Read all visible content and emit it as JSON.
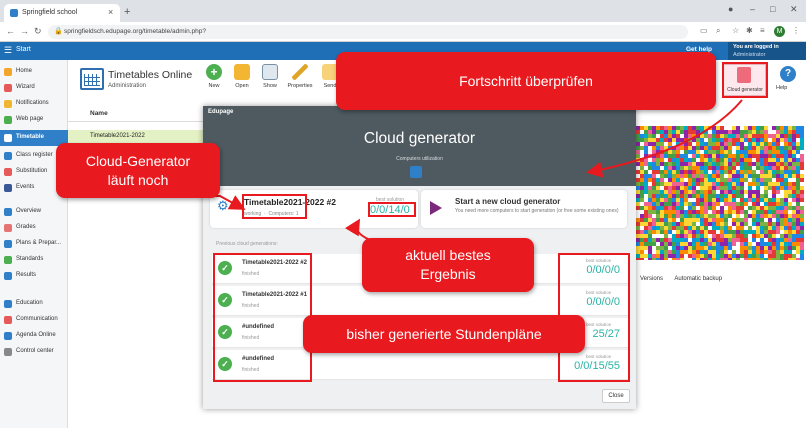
{
  "browser": {
    "tab_title": "Springfield school",
    "tab_close": "×",
    "new_tab": "+",
    "url": "springfieldsch.edupage.org/timetable/admin.php?",
    "avatar_letter": "M"
  },
  "appbar": {
    "start_label": "Start",
    "help_label": "Get help",
    "logged_line1": "You are logged in",
    "logged_line2": "Administrator"
  },
  "sidebar": {
    "items": [
      {
        "label": "Home",
        "color": "#f4a52b"
      },
      {
        "label": "Wizard",
        "color": "#e65a5a"
      },
      {
        "label": "Notifications",
        "color": "#f2b632"
      },
      {
        "label": "Web page",
        "color": "#4caf50"
      },
      {
        "label": "Timetable",
        "color": "#ffffff"
      },
      {
        "label": "Class register",
        "color": "#2f80c9"
      },
      {
        "label": "Substitution",
        "color": "#e65a5a"
      },
      {
        "label": "Events",
        "color": "#3b5998"
      },
      {
        "label": "Overview",
        "color": "#2f80c9"
      },
      {
        "label": "Grades",
        "color": "#e57373"
      },
      {
        "label": "Plans & Prepar...",
        "color": "#2f80c9"
      },
      {
        "label": "Standards",
        "color": "#4caf50"
      },
      {
        "label": "Results",
        "color": "#2f80c9"
      },
      {
        "label": "Education",
        "color": "#2f80c9"
      },
      {
        "label": "Communication",
        "color": "#e65a5a"
      },
      {
        "label": "Agenda Online",
        "color": "#2f80c9"
      },
      {
        "label": "Control center",
        "color": "#888888"
      }
    ]
  },
  "timetables": {
    "title": "Timetables Online",
    "subtitle": "Administration",
    "toolbar": [
      "New",
      "Open",
      "Show",
      "Properties",
      "Send"
    ],
    "list_header": "Name",
    "list_row": "Timetable2021-2022",
    "cloud_btn": "Cloud generator",
    "help_btn": "Help",
    "tabs_behind": [
      "Versions",
      "Automatic backup"
    ]
  },
  "modal": {
    "brand": "Edupage",
    "title": "Cloud generator",
    "utilization": "Computers utilization",
    "running": {
      "name": "Timetable2021-2022 #2",
      "status": "working",
      "computers": "Computers: 1",
      "best_label": "best solution",
      "best_value": "0/0/14/0"
    },
    "start": {
      "title": "Start a new cloud generator",
      "subtitle": "You need more computers to start generation (or free some existing ones)"
    },
    "previous_header": "Previous cloud generations:",
    "previous": [
      {
        "name": "Timetable2021-2022 #2",
        "status": "finished",
        "best_label": "best solution",
        "best_value": "0/0/0/0"
      },
      {
        "name": "Timetable2021-2022 #1",
        "status": "finished",
        "best_label": "best solution",
        "best_value": "0/0/0/0"
      },
      {
        "name": "#undefined",
        "status": "finished",
        "best_label": "best solution",
        "best_value": "25/27"
      },
      {
        "name": "#undefined",
        "status": "finished",
        "best_label": "best solution",
        "best_value": "0/0/15/55"
      }
    ],
    "close_label": "Close"
  },
  "annotations": {
    "check_progress": "Fortschritt überprüfen",
    "still_running_l1": "Cloud-Generator",
    "still_running_l2": "läuft noch",
    "best_result_l1": "aktuell bestes",
    "best_result_l2": "Ergebnis",
    "generated": "bisher generierte Stundenpläne",
    "color": "#e8191f"
  }
}
